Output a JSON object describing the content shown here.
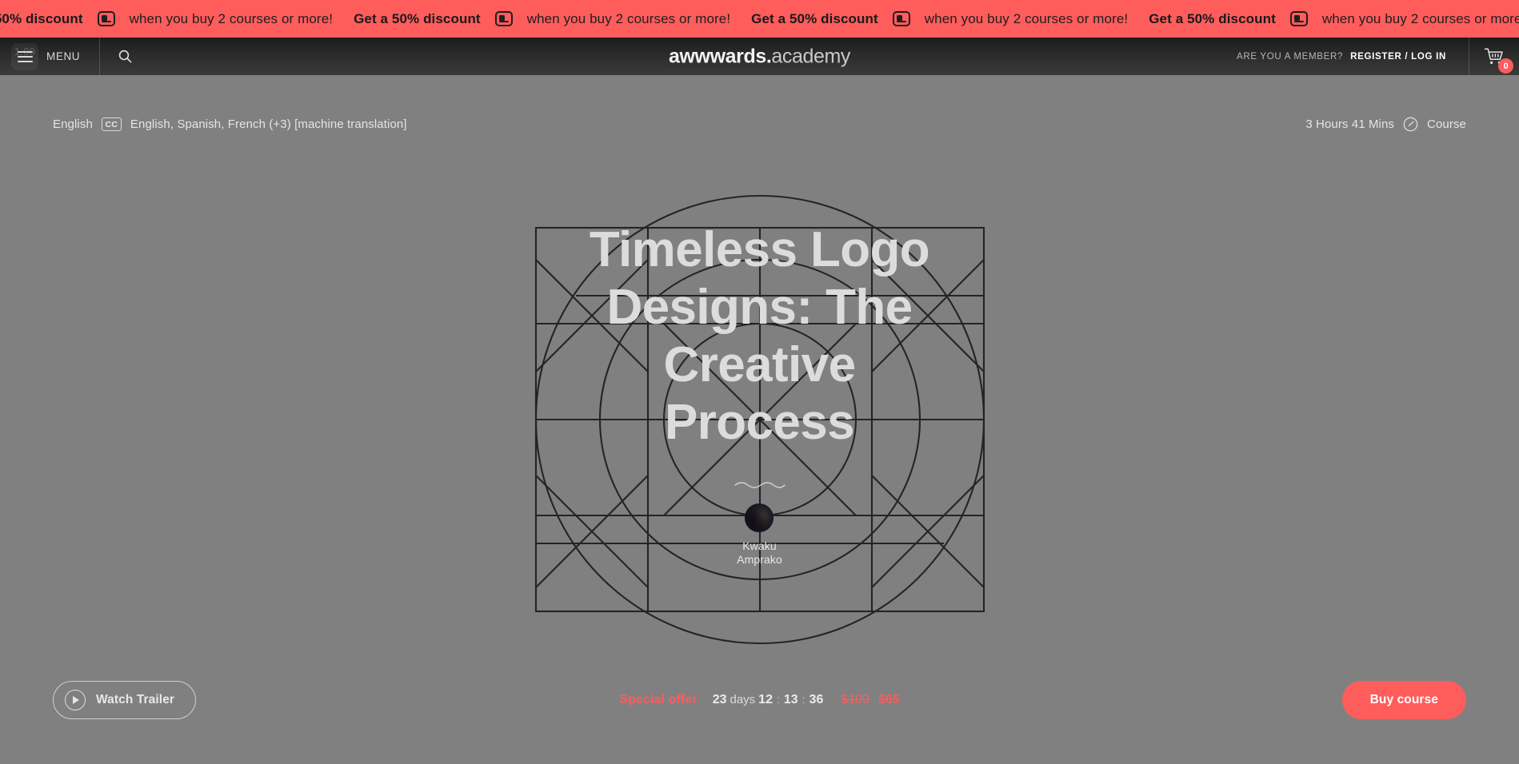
{
  "promo": {
    "strong_text": "Get a 50% discount",
    "light_text": "when you buy 2 courses or more!",
    "icon": "ticket-smiley-icon",
    "background_color": "#ff5c5c"
  },
  "header": {
    "menu_label": "MENU",
    "menu_icon": "hamburger-icon",
    "menu_version": "1.00",
    "search_icon": "search-icon",
    "brand_bold": "awwwards.",
    "brand_light": "academy",
    "member_prompt": "ARE YOU A MEMBER?",
    "auth_link": "REGISTER / LOG IN",
    "cart_icon": "shopping-cart-icon",
    "cart_count": "0"
  },
  "meta": {
    "primary_language": "English",
    "cc_badge": "CC",
    "subtitles": "English, Spanish, French (+3) [machine translation]",
    "duration": "3 Hours 41 Mins",
    "duration_icon": "clock-icon",
    "content_type": "Course"
  },
  "hero": {
    "title": "Timeless Logo Designs: The Creative Process",
    "divider_icon": "squiggle-divider",
    "author_avatar": "author-avatar",
    "author_name_line1": "Kwaku",
    "author_name_line2": "Amprako",
    "background_color": "#808080"
  },
  "bottom": {
    "trailer_label": "Watch Trailer",
    "trailer_icon": "play-icon",
    "offer_label": "Special offer",
    "countdown_days": "23",
    "countdown_days_word": "days",
    "countdown_hours": "12",
    "countdown_minutes": "13",
    "countdown_seconds": "36",
    "colon": ":",
    "price_original": "$100",
    "price_current": "$65",
    "buy_label": "Buy course",
    "accent_color": "#ff5c5c"
  }
}
